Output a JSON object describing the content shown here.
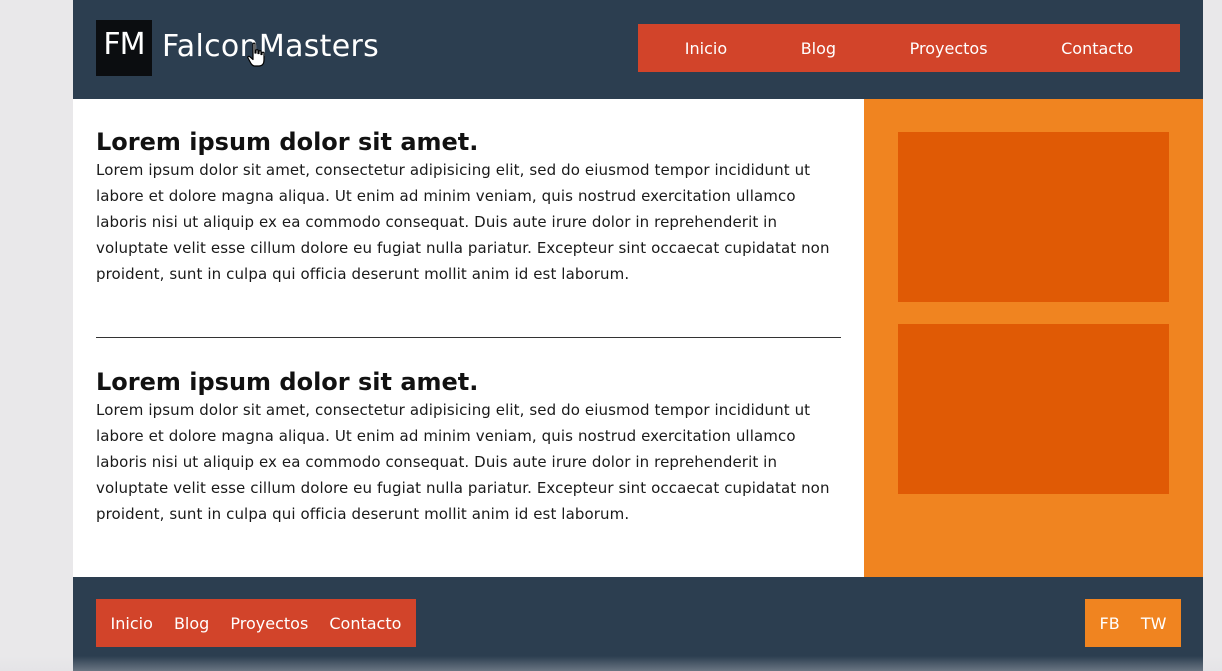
{
  "brand": {
    "logo_text": "FM",
    "name": "FalconMasters"
  },
  "top_nav": {
    "items": [
      {
        "label": "Inicio"
      },
      {
        "label": "Blog"
      },
      {
        "label": "Proyectos"
      },
      {
        "label": "Contacto"
      }
    ]
  },
  "articles": [
    {
      "title": "Lorem ipsum dolor sit amet.",
      "body": "Lorem ipsum dolor sit amet, consectetur adipisicing elit, sed do eiusmod tempor incididunt ut labore et dolore magna aliqua. Ut enim ad minim veniam, quis nostrud exercitation ullamco laboris nisi ut aliquip ex ea commodo consequat. Duis aute irure dolor in reprehenderit in voluptate velit esse cillum dolore eu fugiat nulla pariatur. Excepteur sint occaecat cupidatat non proident, sunt in culpa qui officia deserunt mollit anim id est laborum."
    },
    {
      "title": "Lorem ipsum dolor sit amet.",
      "body": "Lorem ipsum dolor sit amet, consectetur adipisicing elit, sed do eiusmod tempor incididunt ut labore et dolore magna aliqua. Ut enim ad minim veniam, quis nostrud exercitation ullamco laboris nisi ut aliquip ex ea commodo consequat. Duis aute irure dolor in reprehenderit in voluptate velit esse cillum dolore eu fugiat nulla pariatur. Excepteur sint occaecat cupidatat non proident, sunt in culpa qui officia deserunt mollit anim id est laborum."
    }
  ],
  "footer_nav": {
    "items": [
      {
        "label": "Inicio"
      },
      {
        "label": "Blog"
      },
      {
        "label": "Proyectos"
      },
      {
        "label": "Contacto"
      }
    ]
  },
  "social": {
    "items": [
      {
        "label": "FB"
      },
      {
        "label": "TW"
      }
    ]
  },
  "colors": {
    "header_bg": "#2c3e50",
    "nav_bg": "#d2442a",
    "sidebar_bg": "#f08420",
    "sidebar_box": "#e05a05"
  },
  "icons": {
    "cursor": "hand-pointer-icon"
  }
}
